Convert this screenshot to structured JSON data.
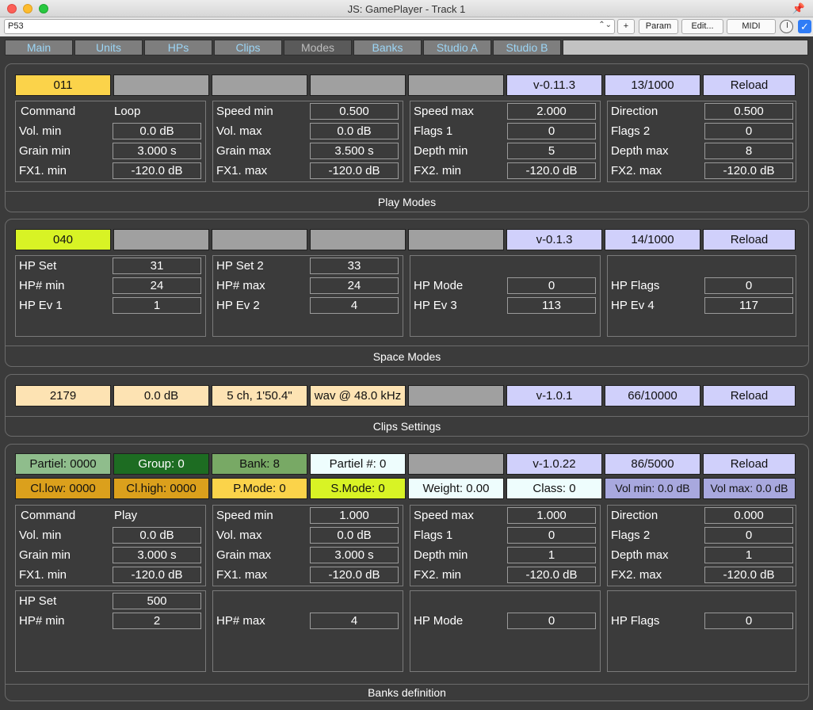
{
  "window": {
    "title": "JS: GamePlayer - Track 1"
  },
  "toolbar": {
    "preset": "P53",
    "plus": "+",
    "param": "Param",
    "edit": "Edit...",
    "midi": "MIDI",
    "bypass_checked": "✓"
  },
  "tabs": [
    "Main",
    "Units",
    "HPs",
    "Clips",
    "Modes",
    "Banks",
    "Studio A",
    "Studio B"
  ],
  "active_tab": "Modes",
  "play": {
    "title": "Play Modes",
    "header": [
      "011",
      "",
      "",
      "",
      "",
      "v-0.11.3",
      "13/1000",
      "Reload"
    ],
    "p1": {
      "r0_label": "Command",
      "r0_value": "Loop",
      "rows": [
        {
          "label": "Vol. min",
          "value": "0.0 dB"
        },
        {
          "label": "Grain min",
          "value": "3.000 s"
        },
        {
          "label": "FX1. min",
          "value": "-120.0 dB"
        }
      ]
    },
    "p2": {
      "rows": [
        {
          "label": "Speed min",
          "value": "0.500"
        },
        {
          "label": "Vol. max",
          "value": "0.0 dB"
        },
        {
          "label": "Grain max",
          "value": "3.500 s"
        },
        {
          "label": "FX1. max",
          "value": "-120.0 dB"
        }
      ]
    },
    "p3": {
      "rows": [
        {
          "label": "Speed max",
          "value": "2.000"
        },
        {
          "label": "Flags 1",
          "value": "0"
        },
        {
          "label": "Depth min",
          "value": "5"
        },
        {
          "label": "FX2. min",
          "value": "-120.0 dB"
        }
      ]
    },
    "p4": {
      "rows": [
        {
          "label": "Direction",
          "value": "0.500"
        },
        {
          "label": "Flags 2",
          "value": "0"
        },
        {
          "label": "Depth max",
          "value": "8"
        },
        {
          "label": "FX2. max",
          "value": "-120.0 dB"
        }
      ]
    }
  },
  "space": {
    "title": "Space Modes",
    "header": [
      "040",
      "",
      "",
      "",
      "",
      "v-0.1.3",
      "14/1000",
      "Reload"
    ],
    "p1": {
      "rows": [
        {
          "label": "HP Set",
          "value": "31"
        },
        {
          "label": "HP# min",
          "value": "24"
        },
        {
          "label": "HP Ev 1",
          "value": "1"
        }
      ]
    },
    "p2": {
      "rows": [
        {
          "label": "HP Set 2",
          "value": "33"
        },
        {
          "label": "HP# max",
          "value": "24"
        },
        {
          "label": "HP Ev 2",
          "value": "4"
        }
      ]
    },
    "p3": {
      "rows": [
        {
          "label": "HP Mode",
          "value": "0"
        },
        {
          "label": "HP Ev 3",
          "value": "113"
        }
      ]
    },
    "p4": {
      "rows": [
        {
          "label": "HP Flags",
          "value": "0"
        },
        {
          "label": "HP Ev 4",
          "value": "117"
        }
      ]
    }
  },
  "clips": {
    "title": "Clips Settings",
    "header": [
      "2179",
      "0.0 dB",
      "5 ch, 1'50.4\"",
      "wav @ 48.0 kHz",
      "",
      "v-1.0.1",
      "66/10000",
      "Reload"
    ]
  },
  "banks": {
    "title": "Banks definition",
    "header1": [
      "Partiel: 0000",
      "Group: 0",
      "Bank: 8",
      "Partiel #: 0",
      "",
      "v-1.0.22",
      "86/5000",
      "Reload"
    ],
    "header2": [
      "Cl.low: 0000",
      "Cl.high: 0000",
      "P.Mode: 0",
      "S.Mode: 0",
      "Weight: 0.00",
      "Class: 0",
      "Vol min: 0.0 dB",
      "Vol max: 0.0 dB"
    ],
    "p1": {
      "r0_label": "Command",
      "r0_value": "Play",
      "rows": [
        {
          "label": "Vol. min",
          "value": "0.0 dB"
        },
        {
          "label": "Grain min",
          "value": "3.000 s"
        },
        {
          "label": "FX1. min",
          "value": "-120.0 dB"
        }
      ]
    },
    "p2": {
      "rows": [
        {
          "label": "Speed min",
          "value": "1.000"
        },
        {
          "label": "Vol. max",
          "value": "0.0 dB"
        },
        {
          "label": "Grain max",
          "value": "3.000 s"
        },
        {
          "label": "FX1. max",
          "value": "-120.0 dB"
        }
      ]
    },
    "p3": {
      "rows": [
        {
          "label": "Speed max",
          "value": "1.000"
        },
        {
          "label": "Flags 1",
          "value": "0"
        },
        {
          "label": "Depth min",
          "value": "1"
        },
        {
          "label": "FX2. min",
          "value": "-120.0 dB"
        }
      ]
    },
    "p4": {
      "rows": [
        {
          "label": "Direction",
          "value": "0.000"
        },
        {
          "label": "Flags 2",
          "value": "0"
        },
        {
          "label": "Depth max",
          "value": "1"
        },
        {
          "label": "FX2. max",
          "value": "-120.0 dB"
        }
      ]
    },
    "q1": {
      "rows": [
        {
          "label": "HP Set",
          "value": "500"
        },
        {
          "label": "HP# min",
          "value": "2"
        }
      ]
    },
    "q2": {
      "rows": [
        {
          "label": "HP# max",
          "value": "4"
        }
      ]
    },
    "q3": {
      "rows": [
        {
          "label": "HP Mode",
          "value": "0"
        }
      ]
    },
    "q4": {
      "rows": [
        {
          "label": "HP Flags",
          "value": "0"
        }
      ]
    }
  }
}
